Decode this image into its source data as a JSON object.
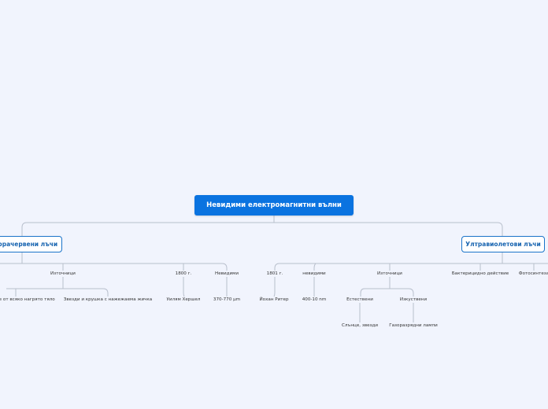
{
  "root": {
    "label": "Невидими електромагнитни вълни"
  },
  "left_branch": {
    "label": "Инфрачервени лъчи",
    "sources": {
      "label": "Източници",
      "items": [
        "Излъчване от всяко нагрято тяло",
        "Звезди и крушка с нажежаема жичка"
      ]
    },
    "year": {
      "label": "1800 г.",
      "child": "Уилям Хершел"
    },
    "invisible": {
      "label": "Невидими",
      "child": "370-770 µm"
    }
  },
  "right_branch": {
    "label": "Ултравиолетови лъчи",
    "year": {
      "label": "1801 г.",
      "child": "Йохан Ритер"
    },
    "invisible": {
      "label": "невидими",
      "child": "400-10 nm"
    },
    "sources": {
      "label": "Източници",
      "natural": {
        "label": "Естествени",
        "child": "Слънце, звезди"
      },
      "artificial": {
        "label": "Изкуствени",
        "child": "Газоразрядни лампи"
      }
    },
    "bactericidal": {
      "label": "Бактерицидно действие"
    },
    "photosynthesis": {
      "label": "Фотосинтеза"
    }
  },
  "colors": {
    "background": "#f1f4fd",
    "root_fill": "#0a73e0",
    "branch_border": "#1a73c9",
    "connector": "#b8bfcc"
  }
}
